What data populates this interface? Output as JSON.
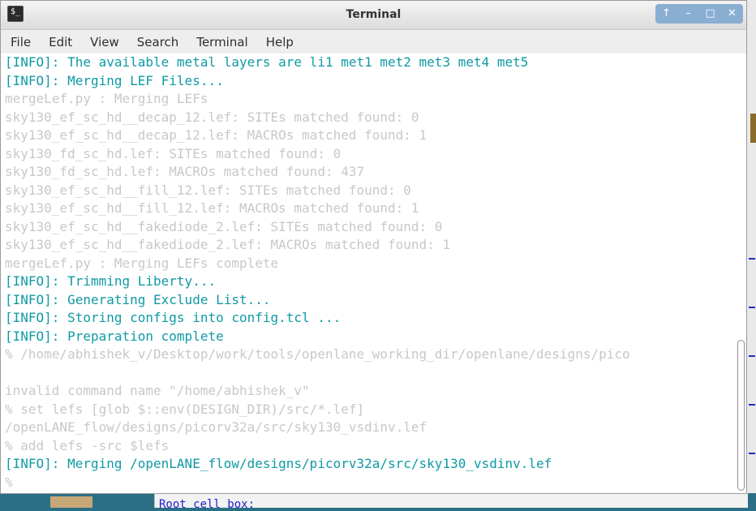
{
  "window": {
    "title": "Terminal",
    "icon": "terminal-app-icon",
    "controls": {
      "up": "↑",
      "minimize": "–",
      "maximize": "□",
      "close": "✕"
    }
  },
  "menu": [
    "File",
    "Edit",
    "View",
    "Search",
    "Terminal",
    "Help"
  ],
  "terminal_lines": [
    {
      "text": "[INFO]: The available metal layers are li1 met1 met2 met3 met4 met5",
      "style": "info"
    },
    {
      "text": "[INFO]: Merging LEF Files...",
      "style": "info"
    },
    {
      "text": "mergeLef.py : Merging LEFs",
      "style": "dim"
    },
    {
      "text": "sky130_ef_sc_hd__decap_12.lef: SITEs matched found: 0",
      "style": "dim"
    },
    {
      "text": "sky130_ef_sc_hd__decap_12.lef: MACROs matched found: 1",
      "style": "dim"
    },
    {
      "text": "sky130_fd_sc_hd.lef: SITEs matched found: 0",
      "style": "dim"
    },
    {
      "text": "sky130_fd_sc_hd.lef: MACROs matched found: 437",
      "style": "dim"
    },
    {
      "text": "sky130_ef_sc_hd__fill_12.lef: SITEs matched found: 0",
      "style": "dim"
    },
    {
      "text": "sky130_ef_sc_hd__fill_12.lef: MACROs matched found: 1",
      "style": "dim"
    },
    {
      "text": "sky130_ef_sc_hd__fakediode_2.lef: SITEs matched found: 0",
      "style": "dim"
    },
    {
      "text": "sky130_ef_sc_hd__fakediode_2.lef: MACROs matched found: 1",
      "style": "dim"
    },
    {
      "text": "mergeLef.py : Merging LEFs complete",
      "style": "dim"
    },
    {
      "text": "[INFO]: Trimming Liberty...",
      "style": "info"
    },
    {
      "text": "[INFO]: Generating Exclude List...",
      "style": "info"
    },
    {
      "text": "[INFO]: Storing configs into config.tcl ...",
      "style": "info"
    },
    {
      "text": "[INFO]: Preparation complete",
      "style": "info"
    },
    {
      "text": "% /home/abhishek_v/Desktop/work/tools/openlane_working_dir/openlane/designs/pico",
      "style": "dim"
    },
    {
      "text": "",
      "style": "dim"
    },
    {
      "text": "invalid command name \"/home/abhishek_v\"",
      "style": "dim"
    },
    {
      "text": "% set lefs [glob $::env(DESIGN_DIR)/src/*.lef]",
      "style": "dim"
    },
    {
      "text": "/openLANE_flow/designs/picorv32a/src/sky130_vsdinv.lef",
      "style": "dim"
    },
    {
      "text": "% add lefs -src $lefs",
      "style": "dim"
    },
    {
      "text": "[INFO]: Merging /openLANE_flow/designs/picorv32a/src/sky130_vsdinv.lef",
      "style": "info"
    },
    {
      "text": "%",
      "style": "dim"
    }
  ],
  "colors": {
    "info": "#0f9aa4",
    "dim": "#c8c8c8",
    "title_buttons": "#8aaed2"
  },
  "background_text": "Root cell box:"
}
